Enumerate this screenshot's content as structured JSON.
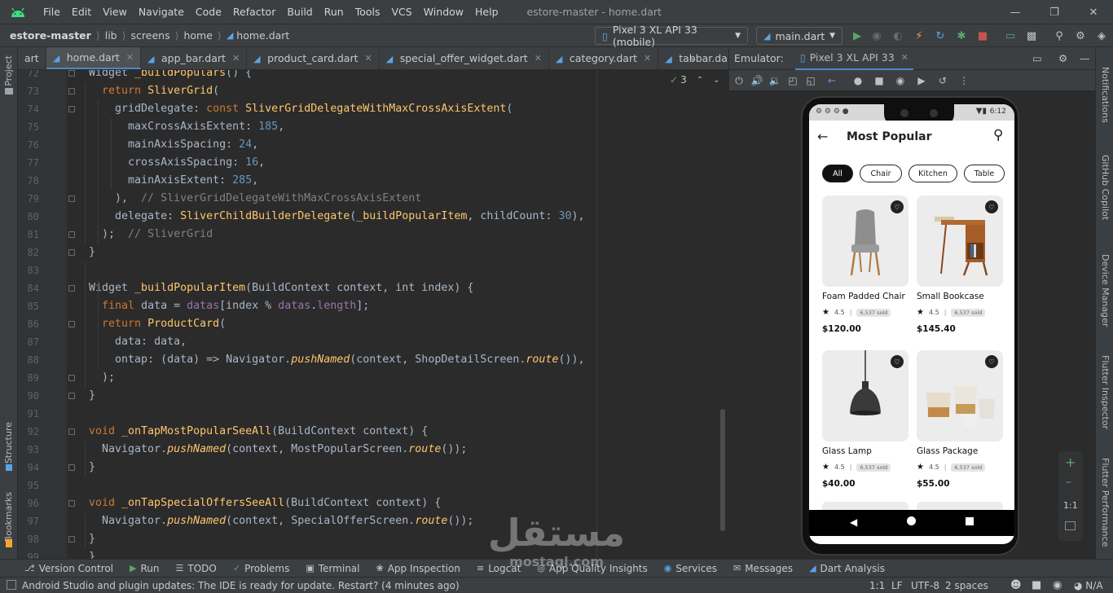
{
  "menubar": {
    "items": [
      "File",
      "Edit",
      "View",
      "Navigate",
      "Code",
      "Refactor",
      "Build",
      "Run",
      "Tools",
      "VCS",
      "Window",
      "Help"
    ],
    "title": "estore-master - home.dart"
  },
  "navbar": {
    "breadcrumb": [
      "estore-master",
      "lib",
      "screens",
      "home",
      "home.dart"
    ],
    "device": "Pixel 3 XL API 33 (mobile)",
    "run_config": "main.dart"
  },
  "tabs": [
    {
      "label": "art",
      "active": false,
      "close": false
    },
    {
      "label": "home.dart",
      "active": true,
      "close": true
    },
    {
      "label": "app_bar.dart",
      "active": false,
      "close": true
    },
    {
      "label": "product_card.dart",
      "active": false,
      "close": true
    },
    {
      "label": "special_offer_widget.dart",
      "active": false,
      "close": true
    },
    {
      "label": "category.dart",
      "active": false,
      "close": true
    },
    {
      "label": "tabbar.dart",
      "active": false,
      "close": true
    }
  ],
  "editor": {
    "inspection_count": "3",
    "lines": [
      {
        "n": "72",
        "html": "<span class='prm'>Widget </span><span class='fn'>_buildPopulars</span>() {"
      },
      {
        "n": "73",
        "html": "  <span class='kw'>return </span><span class='fn'>SliverGrid</span>("
      },
      {
        "n": "74",
        "html": "    <span class='prm'>gridDelegate: </span><span class='kw'>const </span><span class='fn'>SliverGridDelegateWithMaxCrossAxisExtent</span>("
      },
      {
        "n": "75",
        "html": "      <span class='prm'>maxCrossAxisExtent: </span><span class='num'>185</span>,"
      },
      {
        "n": "76",
        "html": "      <span class='prm'>mainAxisSpacing: </span><span class='num'>24</span>,"
      },
      {
        "n": "77",
        "html": "      <span class='prm'>crossAxisSpacing: </span><span class='num'>16</span>,"
      },
      {
        "n": "78",
        "html": "      <span class='prm'>mainAxisExtent: </span><span class='num'>285</span>,"
      },
      {
        "n": "79",
        "html": "    ),  <span class='cm'>// SliverGridDelegateWithMaxCrossAxisExtent</span>"
      },
      {
        "n": "80",
        "html": "    <span class='prm'>delegate: </span><span class='fn'>SliverChildBuilderDelegate</span>(<span class='fn'>_buildPopularItem</span>, <span class='prm'>childCount: </span><span class='num'>30</span>),"
      },
      {
        "n": "81",
        "html": "  );  <span class='cm'>// SliverGrid</span>"
      },
      {
        "n": "82",
        "html": "}"
      },
      {
        "n": "83",
        "html": ""
      },
      {
        "n": "84",
        "html": "<span class='prm'>Widget </span><span class='fn'>_buildPopularItem</span>(BuildContext context, <span class='prm'>int</span> index) {"
      },
      {
        "n": "85",
        "html": "  <span class='kw'>final </span>data = <span class='fld'>datas</span>[index % <span class='fld'>datas</span>.<span class='fld'>length</span>];"
      },
      {
        "n": "86",
        "html": "  <span class='kw'>return </span><span class='fn'>ProductCard</span>("
      },
      {
        "n": "87",
        "html": "    <span class='prm'>data: </span>data,"
      },
      {
        "n": "88",
        "html": "    <span class='prm'>ontap: </span>(data) => Navigator.<span class='it'>pushNamed</span>(context, ShopDetailScreen.<span class='it'>route</span>()),"
      },
      {
        "n": "89",
        "html": "  );"
      },
      {
        "n": "90",
        "html": "}"
      },
      {
        "n": "91",
        "html": ""
      },
      {
        "n": "92",
        "html": "<span class='kw'>void </span><span class='fn'>_onTapMostPopularSeeAll</span>(BuildContext context) {"
      },
      {
        "n": "93",
        "html": "  Navigator.<span class='it'>pushNamed</span>(context, MostPopularScreen.<span class='it'>route</span>());"
      },
      {
        "n": "94",
        "html": "}"
      },
      {
        "n": "95",
        "html": ""
      },
      {
        "n": "96",
        "html": "<span class='kw'>void </span><span class='fn'>_onTapSpecialOffersSeeAll</span>(BuildContext context) {"
      },
      {
        "n": "97",
        "html": "  Navigator.<span class='it'>pushNamed</span>(context, SpecialOfferScreen.<span class='it'>route</span>());"
      },
      {
        "n": "98",
        "html": "}"
      },
      {
        "n": "99",
        "html": "}"
      }
    ]
  },
  "emulator": {
    "header_label": "Emulator:",
    "device_tab": "Pixel 3 XL API 33",
    "status_time": "6:12",
    "app_title": "Most Popular",
    "chips": [
      "All",
      "Chair",
      "Kitchen",
      "Table"
    ],
    "products": [
      {
        "name": "Foam Padded Chair",
        "rating": "4.5",
        "sold": "6,537 sold",
        "price": "$120.00"
      },
      {
        "name": "Small Bookcase",
        "rating": "4.5",
        "sold": "6,537 sold",
        "price": "$145.40"
      },
      {
        "name": "Glass Lamp",
        "rating": "4.5",
        "sold": "6,537 sold",
        "price": "$40.00"
      },
      {
        "name": "Glass Package",
        "rating": "4.5",
        "sold": "6,537 sold",
        "price": "$55.00"
      }
    ],
    "zoom_label": "1:1"
  },
  "right_strip": [
    "Notifications",
    "GitHub Copilot",
    "Device Manager",
    "Flutter Inspector",
    "Flutter Performance"
  ],
  "left_strip": [
    "Project",
    "Structure",
    "Bookmarks"
  ],
  "bottom_tools": [
    {
      "icon": "git-icon",
      "label": "Version Control"
    },
    {
      "icon": "run-icon",
      "label": "Run"
    },
    {
      "icon": "todo-icon",
      "label": "TODO"
    },
    {
      "icon": "problems-icon",
      "label": "Problems"
    },
    {
      "icon": "terminal-icon",
      "label": "Terminal"
    },
    {
      "icon": "app-inspection-icon",
      "label": "App Inspection"
    },
    {
      "icon": "logcat-icon",
      "label": "Logcat"
    },
    {
      "icon": "app-quality-icon",
      "label": "App Quality Insights"
    },
    {
      "icon": "services-icon",
      "label": "Services"
    },
    {
      "icon": "messages-icon",
      "label": "Messages"
    },
    {
      "icon": "dart-analysis-icon",
      "label": "Dart Analysis"
    }
  ],
  "statusline": {
    "message": "Android Studio and plugin updates: The IDE is ready for update. Restart? (4 minutes ago)",
    "position": "1:1",
    "line_sep": "LF",
    "encoding": "UTF-8",
    "indent": "2 spaces",
    "memory": "N/A"
  },
  "watermark": {
    "arabic": "مستقل",
    "latin": "mostaql.com"
  },
  "colors": {
    "accent": "#4a88c7",
    "keyword": "#cc7832",
    "function": "#ffc66d",
    "number": "#6897bb",
    "comment": "#808080",
    "android": "#3ddc84"
  }
}
